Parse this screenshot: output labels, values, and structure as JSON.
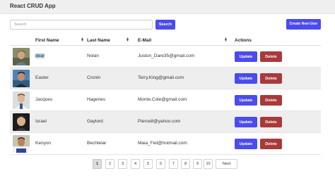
{
  "app": {
    "title": "React CRUD App"
  },
  "search": {
    "placeholder": "Search",
    "button_label": "Search"
  },
  "create_button": {
    "label": "Create New User"
  },
  "table": {
    "headers": {
      "first_name": "First Name",
      "last_name": "Last Name",
      "email": "E-Mail",
      "actions": "Actions"
    },
    "rows": [
      {
        "first_name": "dear",
        "last_name": "Nolan",
        "email": "Juston_Dare35@gmail.com",
        "selected_text": true
      },
      {
        "first_name": "Easter",
        "last_name": "Cronin",
        "email": "Terry.King@gmail.com"
      },
      {
        "first_name": "Jacques",
        "last_name": "Hagenes",
        "email": "Monte.Cole@gmail.com"
      },
      {
        "first_name": "Israel",
        "last_name": "Gaylord",
        "email": "Pierce8@yahoo.com"
      },
      {
        "first_name": "Kenyon",
        "last_name": "Bechtelar",
        "email": "Maia_Feil@hotmail.com"
      }
    ],
    "update_label": "Update",
    "delete_label": "Delete"
  },
  "pagination": {
    "pages": [
      "1",
      "2",
      "3",
      "4",
      "5",
      "6",
      "7",
      "8",
      "9",
      "10"
    ],
    "current": "1",
    "next_label": "Next"
  },
  "colors": {
    "primary": "#4b4bef",
    "danger": "#a83a3a",
    "topbar": "#efefef",
    "row_alt": "#eeeeee"
  }
}
